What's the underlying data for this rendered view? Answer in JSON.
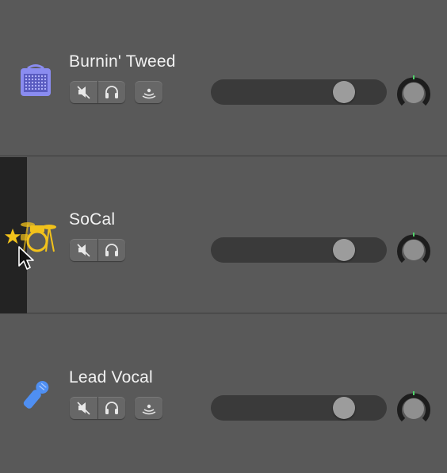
{
  "tracks": [
    {
      "name": "Burnin' Tweed",
      "icon": "amp-icon",
      "icon_color": "#8a8cf0",
      "has_monitor_button": true,
      "volume": 0.8,
      "selected": false
    },
    {
      "name": "SoCal",
      "icon": "drum-kit-icon",
      "icon_color": "#f2c21b",
      "has_monitor_button": false,
      "volume": 0.8,
      "selected": true,
      "favorite": true
    },
    {
      "name": "Lead Vocal",
      "icon": "microphone-icon",
      "icon_color": "#4f8ff2",
      "has_monitor_button": true,
      "volume": 0.8,
      "selected": false
    }
  ],
  "colors": {
    "background": "#595959",
    "selected_strip": "#232323",
    "knob_indicator": "#4fd36a",
    "star": "#f2c21b"
  }
}
